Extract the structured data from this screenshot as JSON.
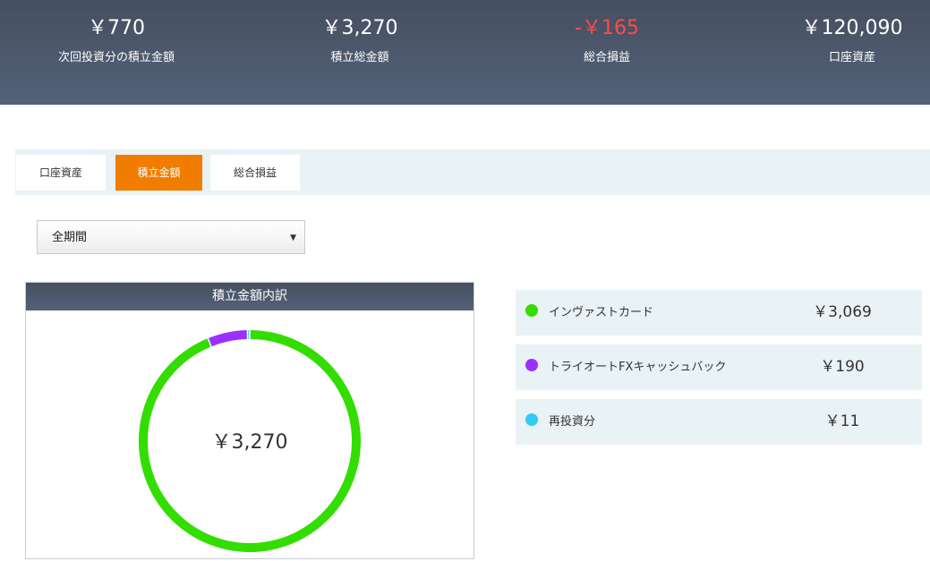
{
  "summary": {
    "next_amount": "￥770",
    "next_label": "次回投資分の積立金額",
    "total_amount": "￥3,270",
    "total_label": "積立総金額",
    "pnl_amount": "-￥165",
    "pnl_label": "総合損益",
    "assets_amount": "￥120,090",
    "assets_label": "口座資産"
  },
  "tabs": [
    {
      "label": "口座資産"
    },
    {
      "label": "積立金額"
    },
    {
      "label": "総合損益"
    }
  ],
  "period_select": {
    "value": "全期間"
  },
  "panel": {
    "title": "積立金額内訳",
    "center_value": "￥3,270"
  },
  "colors": {
    "green": "#33dd00",
    "purple": "#9b30ff",
    "cyan": "#33ccf5",
    "accent": "#f07d00",
    "negative": "#ff4a4a"
  },
  "chart_data": {
    "type": "pie",
    "categories": [
      "インヴァストカード",
      "トライオートFXキャッシュバック",
      "再投資分"
    ],
    "values": [
      3069,
      190,
      11
    ],
    "colors": [
      "#33dd00",
      "#9b30ff",
      "#33ccf5"
    ],
    "center_label": "￥3,270"
  },
  "legend": [
    {
      "name": "インヴァストカード",
      "value": "￥3,069",
      "color": "#33dd00"
    },
    {
      "name": "トライオートFXキャッシュバック",
      "value": "￥190",
      "color": "#9b30ff"
    },
    {
      "name": "再投資分",
      "value": "￥11",
      "color": "#33ccf5"
    }
  ]
}
